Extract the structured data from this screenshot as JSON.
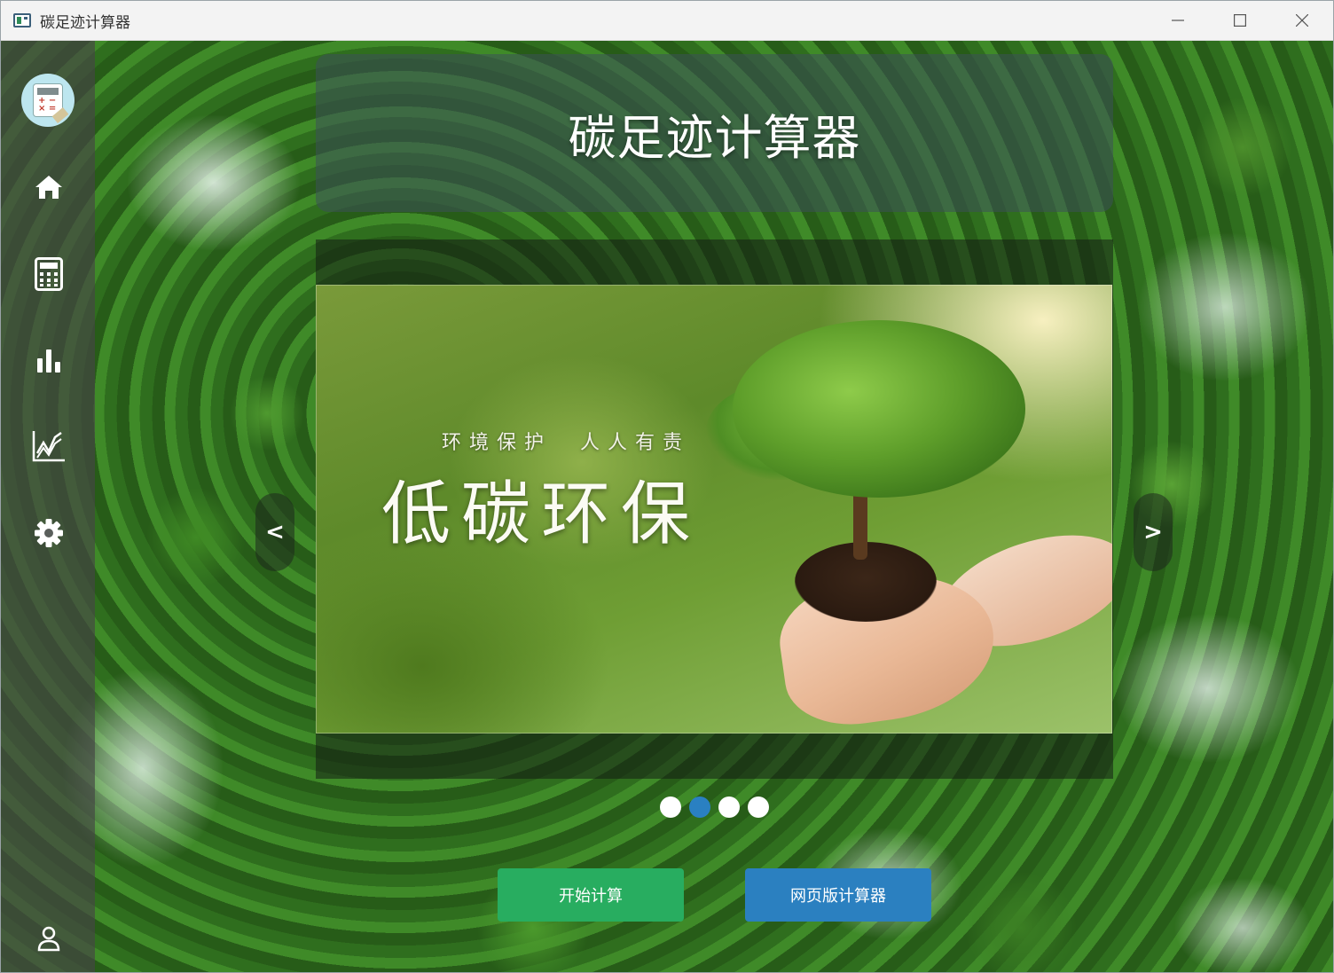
{
  "window": {
    "title": "碳足迹计算器",
    "controls": [
      "minimize-icon",
      "maximize-icon",
      "close-icon"
    ]
  },
  "sidebar": {
    "logo": "calculator-logo",
    "items": [
      {
        "icon": "home-icon"
      },
      {
        "icon": "calculator-icon"
      },
      {
        "icon": "bar-chart-icon"
      },
      {
        "icon": "line-chart-icon"
      },
      {
        "icon": "gear-icon"
      }
    ],
    "bottom": {
      "icon": "user-icon"
    }
  },
  "header": {
    "title": "碳足迹计算器"
  },
  "carousel": {
    "slide": {
      "subtitle": "环境保护  人人有责",
      "headline": "低碳环保"
    },
    "prev_label": "<",
    "next_label": ">",
    "dots_total": 4,
    "active_index": 1
  },
  "actions": {
    "start_label": "开始计算",
    "web_label": "网页版计算器"
  },
  "colors": {
    "start_button": "#28ad60",
    "web_button": "#2b80c0",
    "active_dot": "#2a80c2"
  }
}
